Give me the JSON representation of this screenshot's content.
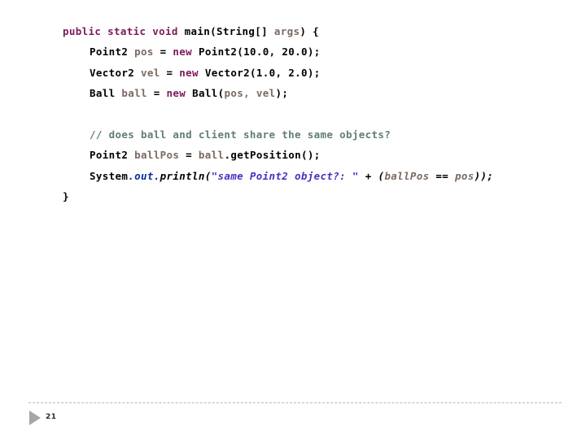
{
  "slide": {
    "page_number": "21",
    "nav_arrow_icon": "play-triangle-icon",
    "code": {
      "line1": {
        "kw": "public static void ",
        "name": "main(String[] ",
        "param": "args",
        "close": ") {"
      },
      "line2": {
        "type": "Point2 ",
        "var": "pos",
        "eq": " = ",
        "kw": "new",
        "ctor": " Point2(10.0, 20.0);"
      },
      "line3": {
        "type": "Vector2 ",
        "var": "vel",
        "eq": " = ",
        "kw": "new",
        "ctor": " Vector2(1.0, 2.0);"
      },
      "line4": {
        "type": "Ball ",
        "var": "ball",
        "eq": " = ",
        "kw": "new",
        "ctor": " Ball(",
        "args": "pos, vel",
        "end": ");"
      },
      "line5_comment": "// does ball and client share the same objects?",
      "line6": {
        "type": "Point2 ",
        "var": "ballPos",
        "eq": " = ",
        "recv": "ball",
        "call": ".getPosition();"
      },
      "line7": {
        "sys": "System",
        "field": ".out.",
        "method": "println(",
        "string": "\"same Point2 object?: \"",
        "plus": " + (",
        "lhs": "ballPos",
        "op": " == ",
        "rhs": "pos",
        "end": "));"
      },
      "line8_close": "}"
    }
  },
  "colors": {
    "keyword": "#7b1a5c",
    "identifier": "#7a6a62",
    "comment": "#5f7f6f",
    "field": "#0b2f9e",
    "string": "#4b2fc4",
    "plain": "#000000",
    "rule": "#b9b9b9",
    "arrow": "#a6a6a6",
    "background": "#ffffff"
  }
}
